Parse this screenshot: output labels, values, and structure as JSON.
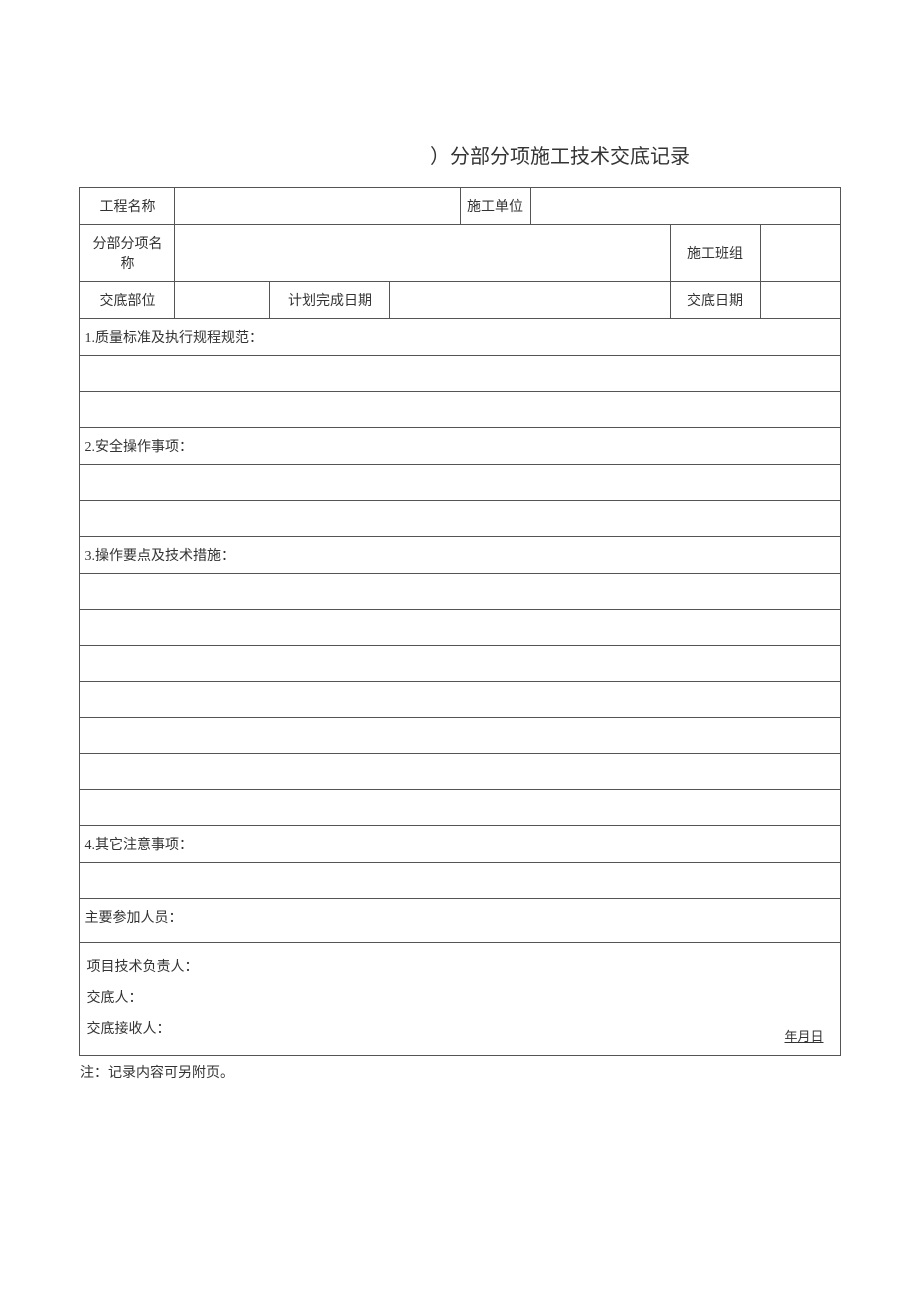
{
  "title": "）分部分项施工技术交底记录",
  "header": {
    "row1": {
      "label1": "工程名称",
      "value1": "",
      "label2": "施工单位",
      "value2": ""
    },
    "row2": {
      "label1": "分部分项名称",
      "value1": "",
      "label2": "施工班组",
      "value2": ""
    },
    "row3": {
      "label1": "交底部位",
      "value1": "",
      "label2": "计划完成日期",
      "value2": "",
      "label3": "交底日期",
      "value3": ""
    }
  },
  "sections": {
    "s1": "1.质量标准及执行规程规范：",
    "s2": "2.安全操作事项：",
    "s3": "3.操作要点及技术措施：",
    "s4": "4.其它注意事项：",
    "participants": "主要参加人员："
  },
  "signatures": {
    "tech_lead": "项目技术负责人：",
    "presenter": "交底人：",
    "receiver": "交底接收人：",
    "date": "年月日"
  },
  "footnote": "注：记录内容可另附页。"
}
